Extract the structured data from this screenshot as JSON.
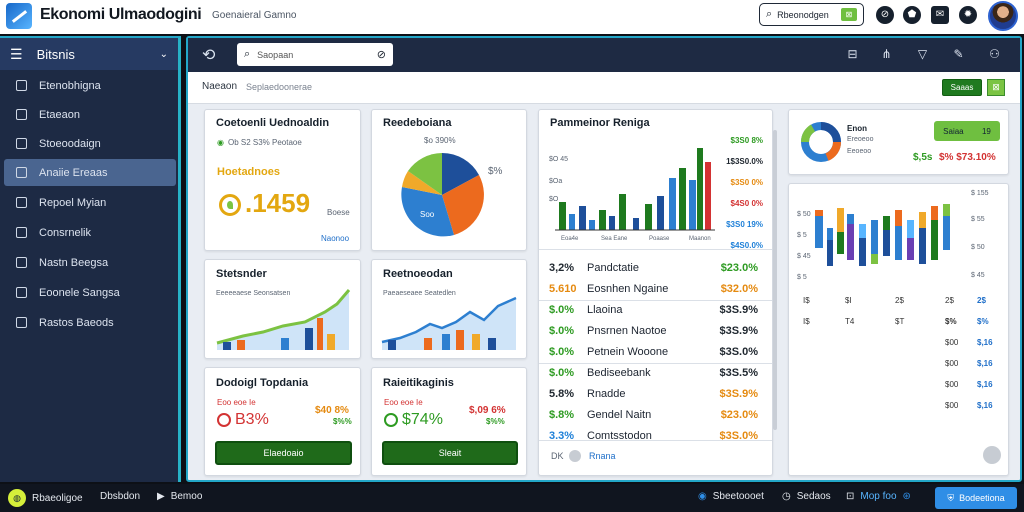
{
  "app": {
    "title": "Ekonomi Ulmaodogini",
    "subtitle": "Goenaieral Gamno"
  },
  "top_search": {
    "value": "Rbeonodgen",
    "chip": "⊠"
  },
  "top_icons": [
    {
      "name": "link-icon",
      "glyph": "⊘"
    },
    {
      "name": "shield-icon",
      "glyph": "⬟"
    },
    {
      "name": "mail-icon",
      "glyph": "✉"
    },
    {
      "name": "settings-icon",
      "glyph": "✹"
    }
  ],
  "sidebar": {
    "header": "Bitsnis",
    "items": [
      {
        "label": "Etenobhigna",
        "icon": "▯"
      },
      {
        "label": "Etaeaon",
        "icon": "□"
      },
      {
        "label": "Stoeoodaign",
        "icon": "□"
      },
      {
        "label": "Anaiie Ereaas",
        "icon": "✎"
      },
      {
        "label": "Repoel Myian",
        "icon": "▣"
      },
      {
        "label": "Consrnelik",
        "icon": "⌂"
      },
      {
        "label": "Nastn Beegsa",
        "icon": "▮"
      },
      {
        "label": "Eoonele Sangsa",
        "icon": "▭"
      },
      {
        "label": "Rastos Baeods",
        "icon": "▩"
      }
    ]
  },
  "nav": {
    "search_placeholder": "Saopaan"
  },
  "breadcrumbs": {
    "first": "Naeaon",
    "second": "Seplaedoonerae",
    "btn": "Saaas",
    "sq": "⊠"
  },
  "cards": {
    "c1": {
      "title": "Coetoenli Uednoaldin",
      "line": "Ob S2 S3% Peotaoe",
      "sub": "Hoetadnoes",
      "big": ".1459",
      "small": "Boese",
      "link": "Naonoo"
    },
    "c2": {
      "title": "Reedeboiana",
      "top": "$o 390%",
      "right": "$%",
      "center": "Soo"
    },
    "c3": {
      "title": "Stetsnder",
      "legend": "Eeeeeaese Seonsatsen"
    },
    "c4": {
      "title": "Reetnoeodan",
      "legend": "Paeaeseaee Seatedlen"
    },
    "c5": {
      "title": "Dodoigl Topdania",
      "line": "Eoo eoe Ie",
      "pct": "B3%",
      "r1": "$40 8%",
      "r2": "$%%",
      "btn": "Elaedoaio"
    },
    "c6": {
      "title": "Raieitikaginis",
      "line": "Eoo eoe Ie",
      "pct": "$74%",
      "r1": "$,09 6%",
      "r2": "$%%",
      "btn": "Sleait"
    }
  },
  "table": {
    "title": "Pammeinor Reniga",
    "chart_labels": [
      "$O 45",
      "$Oa",
      "$O",
      "$O",
      "$O"
    ],
    "chart_right": [
      "$3S0 8%",
      "1$3S0.0%",
      "$3S0 0%",
      "$4S0 0%",
      "$3S0 19%",
      "$4S0.0%"
    ],
    "xlabels": [
      "Eoa4e",
      "Sea Eane",
      "Poaase",
      "Maanon"
    ],
    "rows": [
      {
        "a": "3,2%",
        "b": "Pandctatie",
        "c": "$23.0%",
        "ac": "k",
        "cc": "g"
      },
      {
        "a": "5.610",
        "b": "Eosnhen Ngaine",
        "c": "$32.0%",
        "ac": "o",
        "cc": "o"
      },
      {
        "a": "$.0%",
        "b": "Llaoina",
        "c": "$3S.9%",
        "ac": "g",
        "cc": "k"
      },
      {
        "a": "$.0%",
        "b": "Pnsrnen Naotoe",
        "c": "$3S.9%",
        "ac": "g",
        "cc": "k"
      },
      {
        "a": "$.0%",
        "b": "Petnein Wooone",
        "c": "$3S.0%",
        "ac": "g",
        "cc": "k"
      },
      {
        "a": "$.0%",
        "b": "Bediseebank",
        "c": "$3S.5%",
        "ac": "g",
        "cc": "k"
      },
      {
        "a": "5.8%",
        "b": "Rnadde",
        "c": "$3S.9%",
        "ac": "k",
        "cc": "o"
      },
      {
        "a": "$.8%",
        "b": "Gendel Naitn",
        "c": "$23.0%",
        "ac": "g",
        "cc": "o"
      },
      {
        "a": "3.3%",
        "b": "Comtsstodon",
        "c": "$3S.0%",
        "ac": "bl",
        "cc": "o"
      }
    ],
    "foot_a": "DK",
    "foot_b": "Rnana"
  },
  "right": {
    "donut_title": "Enon",
    "donut_l1": "Ereoeoo",
    "donut_l2": "Eeoeoo",
    "pill": "Saiaa",
    "pill_num": "19",
    "r1": "$,5s",
    "r2": "$% $73.10%",
    "chart_top": "$ 155",
    "yl": [
      "$ 50",
      "$ 5",
      "$ 45",
      "$ 5"
    ],
    "xr": [
      "$ 55",
      "$ 50",
      "$ 45"
    ],
    "rows": [
      [
        "I$",
        "$I",
        "2$",
        "2$",
        "2$"
      ],
      [
        "I$",
        "T4",
        "$T",
        "$%",
        "$%"
      ],
      [
        "",
        "",
        "",
        "$00",
        "$,16"
      ],
      [
        "",
        "",
        "",
        "$00",
        "$,16"
      ],
      [
        "",
        "",
        "",
        "$00",
        "$,16"
      ],
      [
        "",
        "",
        "",
        "$00",
        "$,16"
      ]
    ]
  },
  "bottom": {
    "left1": "Rbaeoligoe",
    "left2": "Dbsbdon",
    "left3": "Bemoo",
    "r1": "Sbeetoooet",
    "r2": "Sedaos",
    "r3": "Mop foo",
    "btn": "Bodeetiona"
  }
}
